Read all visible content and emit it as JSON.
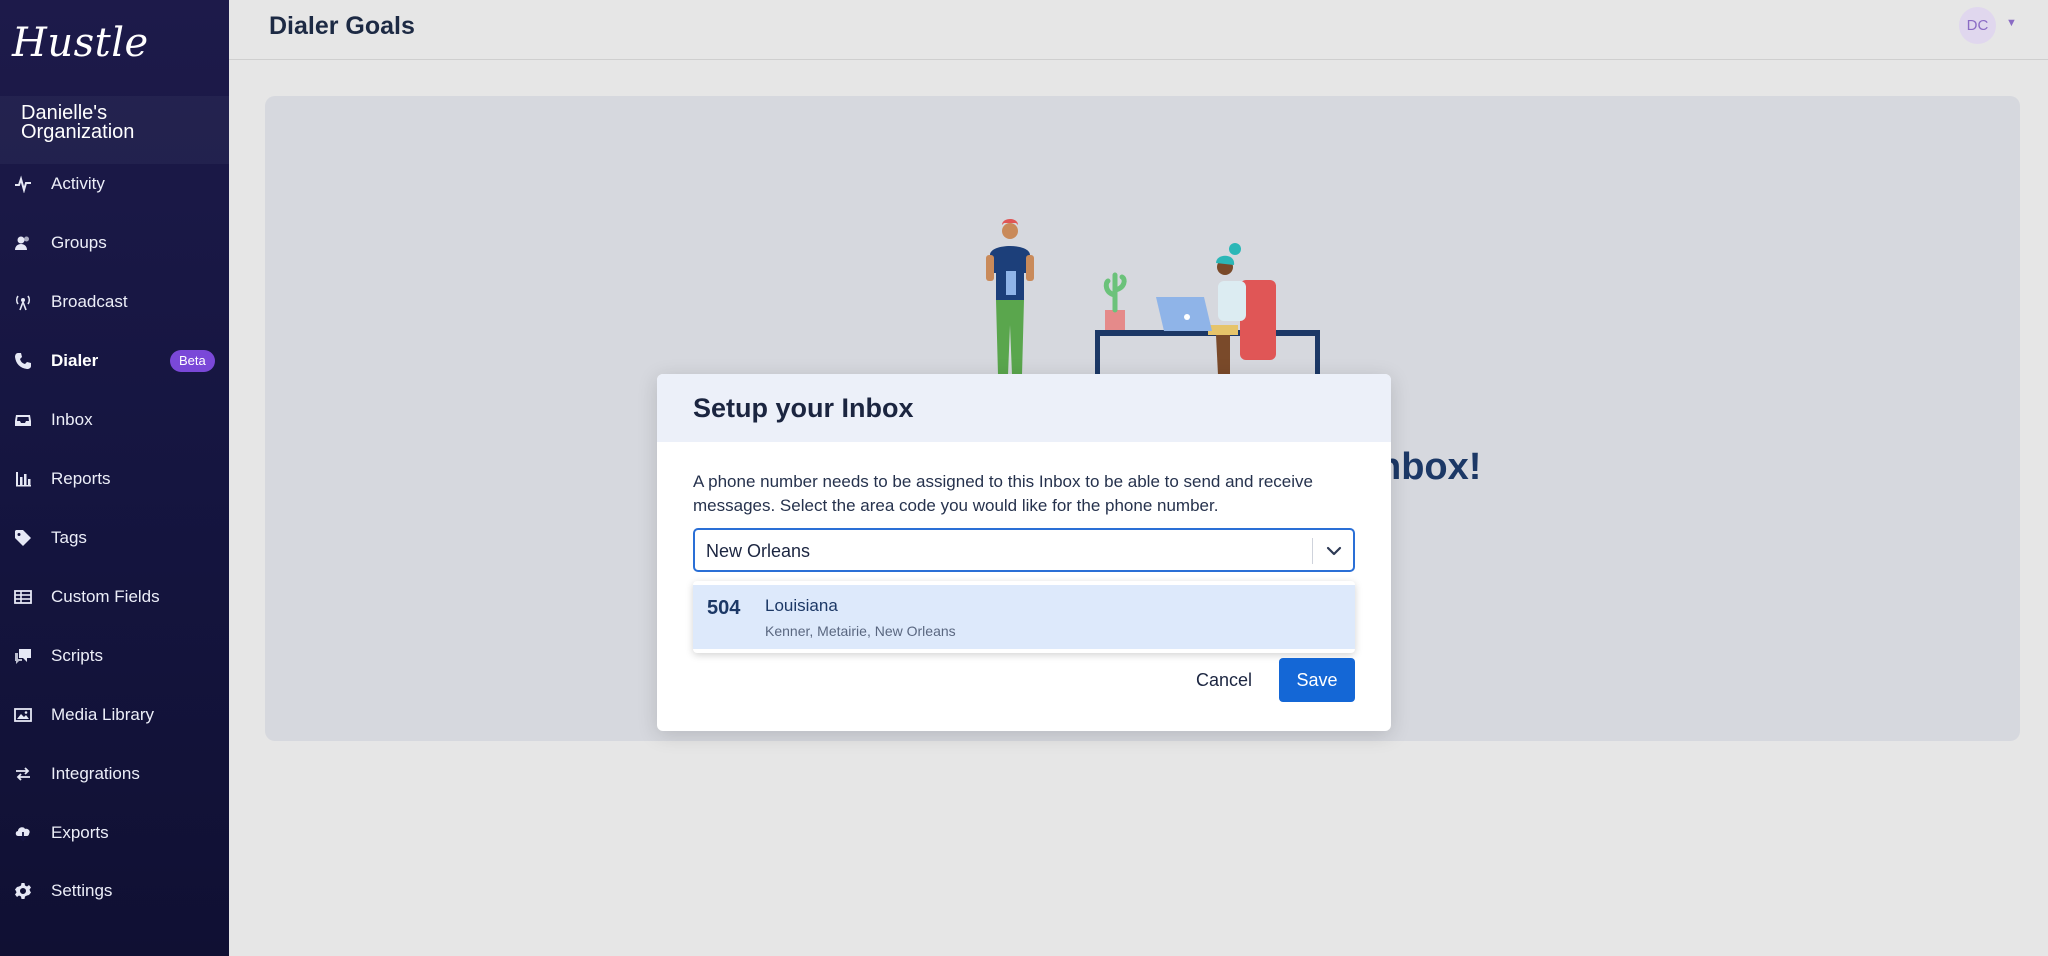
{
  "sidebar": {
    "logo": "Hustle",
    "org_name": "Danielle's Organization",
    "items": [
      {
        "label": "Activity",
        "icon": "activity-icon"
      },
      {
        "label": "Groups",
        "icon": "groups-icon"
      },
      {
        "label": "Broadcast",
        "icon": "broadcast-icon"
      },
      {
        "label": "Dialer",
        "icon": "phone-icon",
        "active": true,
        "badge": "Beta"
      },
      {
        "label": "Inbox",
        "icon": "inbox-icon"
      },
      {
        "label": "Reports",
        "icon": "reports-icon"
      },
      {
        "label": "Tags",
        "icon": "tag-icon"
      },
      {
        "label": "Custom Fields",
        "icon": "custom-fields-icon"
      },
      {
        "label": "Scripts",
        "icon": "scripts-icon"
      },
      {
        "label": "Media Library",
        "icon": "image-icon"
      },
      {
        "label": "Integrations",
        "icon": "integrations-icon"
      },
      {
        "label": "Exports",
        "icon": "cloud-download-icon"
      },
      {
        "label": "Settings",
        "icon": "gear-icon"
      }
    ]
  },
  "header": {
    "title": "Dialer Goals",
    "avatar_initials": "DC"
  },
  "background": {
    "heading_fragment": "nbox!"
  },
  "modal": {
    "title": "Setup your Inbox",
    "description": "A phone number needs to be assigned to this Inbox to be able to send and receive messages. Select the area code you would like for the phone number.",
    "select_value": "New Orleans",
    "option": {
      "code": "504",
      "state": "Louisiana",
      "cities": "Kenner, Metairie, New Orleans"
    },
    "cancel_label": "Cancel",
    "save_label": "Save"
  },
  "colors": {
    "sidebar_bg": "#181845",
    "accent": "#1467d6",
    "badge": "#7a48d8",
    "option_highlight": "#dde9fb"
  }
}
